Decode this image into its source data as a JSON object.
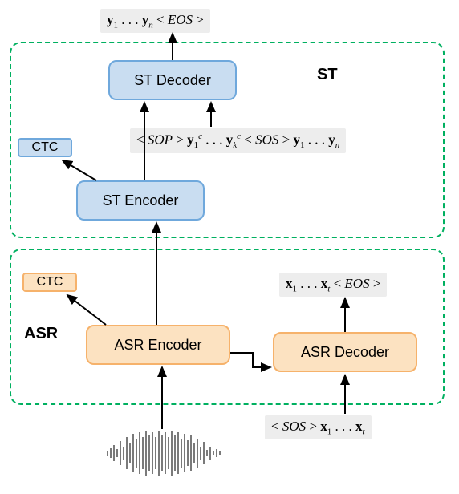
{
  "st_label": "ST",
  "asr_label": "ASR",
  "st_decoder": "ST Decoder",
  "st_encoder": "ST Encoder",
  "asr_encoder": "ASR Encoder",
  "asr_decoder": "ASR Decoder",
  "ctc_st": "CTC",
  "ctc_asr": "CTC",
  "output_top": "<span class='bvec'>y</span><span class='sub'>1</span>&nbsp;.&nbsp;.&nbsp;.&nbsp;<span class='bvec'>y</span><span class='sub'><i>n</i></span>&nbsp;&lt; <i>EOS</i> &gt;",
  "st_input": "&lt; <i>SOP</i> &gt; <span class='bvec'>y</span><span class='sub'>1</span><span class='sup'><i>c</i></span>&nbsp;.&nbsp;.&nbsp;.&nbsp;<span class='bvec'>y</span><span class='sub'><i>k</i></span><span class='sup'><i>c</i></span> &lt; <i>SOS</i> &gt; <span class='bvec'>y</span><span class='sub'>1</span>&nbsp;.&nbsp;.&nbsp;.&nbsp;<span class='bvec'>y</span><span class='sub'><i>n</i></span>",
  "asr_output": "<span class='bvec'>x</span><span class='sub'>1</span>&nbsp;.&nbsp;.&nbsp;.&nbsp;<span class='bvec'>x</span><span class='sub'><i>t</i></span>&nbsp;&lt; <i>EOS</i> &gt;",
  "asr_input": "&lt; <i>SOS</i> &gt; <span class='bvec'>x</span><span class='sub'>1</span>&nbsp;.&nbsp;.&nbsp;.&nbsp;<span class='bvec'>x</span><span class='sub'><i>t</i></span>"
}
